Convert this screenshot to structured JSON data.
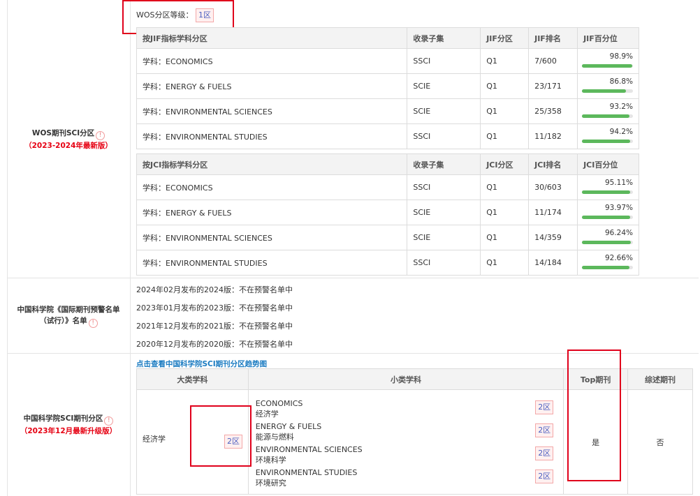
{
  "wos": {
    "label": "WOS期刊SCI分区",
    "sub": "（2023-2024年最新版）",
    "level_label": "WOS分区等级：",
    "level_value": "1区",
    "jif_table": {
      "headers": [
        "按JIF指标学科分区",
        "收录子集",
        "JIF分区",
        "JIF排名",
        "JIF百分位"
      ],
      "rows": [
        {
          "subject": "学科：ECONOMICS",
          "set": "SSCI",
          "q": "Q1",
          "rank": "7/600",
          "pct": "98.9%",
          "v": 98.9
        },
        {
          "subject": "学科：ENERGY & FUELS",
          "set": "SCIE",
          "q": "Q1",
          "rank": "23/171",
          "pct": "86.8%",
          "v": 86.8
        },
        {
          "subject": "学科：ENVIRONMENTAL SCIENCES",
          "set": "SCIE",
          "q": "Q1",
          "rank": "25/358",
          "pct": "93.2%",
          "v": 93.2
        },
        {
          "subject": "学科：ENVIRONMENTAL STUDIES",
          "set": "SSCI",
          "q": "Q1",
          "rank": "11/182",
          "pct": "94.2%",
          "v": 94.2
        }
      ]
    },
    "jci_table": {
      "headers": [
        "按JCI指标学科分区",
        "收录子集",
        "JCI分区",
        "JCI排名",
        "JCI百分位"
      ],
      "rows": [
        {
          "subject": "学科：ECONOMICS",
          "set": "SSCI",
          "q": "Q1",
          "rank": "30/603",
          "pct": "95.11%",
          "v": 95.11
        },
        {
          "subject": "学科：ENERGY & FUELS",
          "set": "SCIE",
          "q": "Q1",
          "rank": "11/174",
          "pct": "93.97%",
          "v": 93.97
        },
        {
          "subject": "学科：ENVIRONMENTAL SCIENCES",
          "set": "SCIE",
          "q": "Q1",
          "rank": "14/359",
          "pct": "96.24%",
          "v": 96.24
        },
        {
          "subject": "学科：ENVIRONMENTAL STUDIES",
          "set": "SSCI",
          "q": "Q1",
          "rank": "14/184",
          "pct": "92.66%",
          "v": 92.66
        }
      ]
    }
  },
  "warning": {
    "label": "中国科学院《国际期刊预警名单（试行）》名单",
    "lines": [
      "2024年02月发布的2024版：不在预警名单中",
      "2023年01月发布的2023版：不在预警名单中",
      "2021年12月发布的2021版：不在预警名单中",
      "2020年12月发布的2020版：不在预警名单中"
    ]
  },
  "cas": {
    "label": "中国科学院SCI期刊分区",
    "sub": "（2023年12月最新升级版）",
    "link": "点击查看中国科学院SCI期刊分区趋势图",
    "headers": [
      "大类学科",
      "小类学科",
      "Top期刊",
      "综述期刊"
    ],
    "major": "经济学",
    "major_zone": "2区",
    "minors": [
      {
        "en": "ECONOMICS",
        "zh": "经济学",
        "zone": "2区"
      },
      {
        "en": "ENERGY & FUELS",
        "zh": "能源与燃料",
        "zone": "2区"
      },
      {
        "en": "ENVIRONMENTAL SCIENCES",
        "zh": "环境科学",
        "zone": "2区"
      },
      {
        "en": "ENVIRONMENTAL STUDIES",
        "zh": "环境研究",
        "zone": "2区"
      }
    ],
    "top": "是",
    "review": "否"
  },
  "info_icon": "!"
}
